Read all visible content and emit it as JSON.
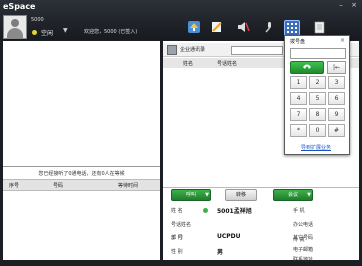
{
  "app": {
    "title": "eSpace"
  },
  "window": {
    "minimize": "–",
    "close": "×"
  },
  "user": {
    "id": "5000",
    "status": "空闲",
    "status_caret": "▼",
    "welcome": "欢迎您，5000 (已签入)"
  },
  "toolbar": {
    "icons": [
      "upload-icon",
      "edit-icon",
      "volume-icon",
      "microphone-icon",
      "keypad-icon",
      "notes-icon"
    ]
  },
  "queue": {
    "status": "您已经接听了0通电话，还有0人在等候",
    "columns": [
      "序号",
      "号码",
      "等待时间"
    ]
  },
  "addressbook": {
    "title": "企业通讯录",
    "columns": [
      "姓名",
      "号话姓名"
    ]
  },
  "actions": {
    "call": "呼叫",
    "transfer": "转移",
    "conference": "会议"
  },
  "contact": {
    "labels": {
      "name": "姓 名",
      "alias": "号话姓名",
      "job_no": "工 号",
      "gender": "性 别",
      "dept": "部 门",
      "mobile": "手 机",
      "office": "办公电话",
      "other": "其它号码",
      "fax": "传 真",
      "email": "电子邮箱",
      "address": "联系地址"
    },
    "values": {
      "name": "5001孟祥旭",
      "gender": "男",
      "dept": "UCPDU"
    }
  },
  "dialpad": {
    "title": "拨号盘",
    "close": "×",
    "backspace": "|←",
    "keys": [
      "1",
      "2",
      "3",
      "4",
      "5",
      "6",
      "7",
      "8",
      "9",
      "*",
      "0",
      "#"
    ],
    "link": "导到扩展业务"
  }
}
